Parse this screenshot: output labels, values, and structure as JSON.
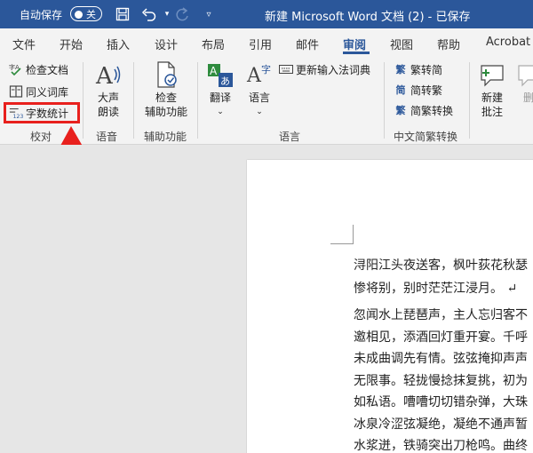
{
  "titlebar": {
    "autosave_label": "自动保存",
    "autosave_state": "关",
    "doc_title": "新建 Microsoft Word 文档 (2)  -  已保存"
  },
  "tabs": [
    "文件",
    "开始",
    "插入",
    "设计",
    "布局",
    "引用",
    "邮件",
    "审阅",
    "视图",
    "帮助",
    "Acrobat"
  ],
  "active_tab": "审阅",
  "ribbon": {
    "proofing": {
      "spellcheck": "检查文档",
      "thesaurus": "同义词库",
      "wordcount": "字数统计",
      "label": "校对"
    },
    "speech": {
      "read_aloud_1": "大声",
      "read_aloud_2": "朗读",
      "label": "语音"
    },
    "accessibility": {
      "check_1": "检查",
      "check_2": "辅助功能",
      "label": "辅助功能"
    },
    "language": {
      "translate": "翻译",
      "language": "语言",
      "update_ime": "更新输入法词典",
      "label": "语言"
    },
    "chinese": {
      "trad_to_simp": "繁转简",
      "simp_to_trad": "简转繁",
      "conversion": "简繁转换",
      "label": "中文简繁转换"
    },
    "comments": {
      "new_1": "新建",
      "new_2": "批注",
      "delete": "删"
    }
  },
  "document": {
    "lines": [
      "浔阳江头夜送客，枫叶荻花秋瑟",
      "惨将别，别时茫茫江浸月。 ↵",
      "忽闻水上琵琶声，主人忘归客不",
      "邀相见，添酒回灯重开宴。千呼",
      "未成曲调先有情。弦弦掩抑声声",
      "无限事。轻拢慢捻抹复挑，初为",
      "如私语。嘈嘈切切错杂弹，大珠",
      "冰泉冷涩弦凝绝，凝绝不通声暂",
      "水浆迸，铁骑突出刀枪鸣。曲终"
    ]
  },
  "colors": {
    "accent": "#2b579a",
    "highlight": "#e8201d"
  }
}
